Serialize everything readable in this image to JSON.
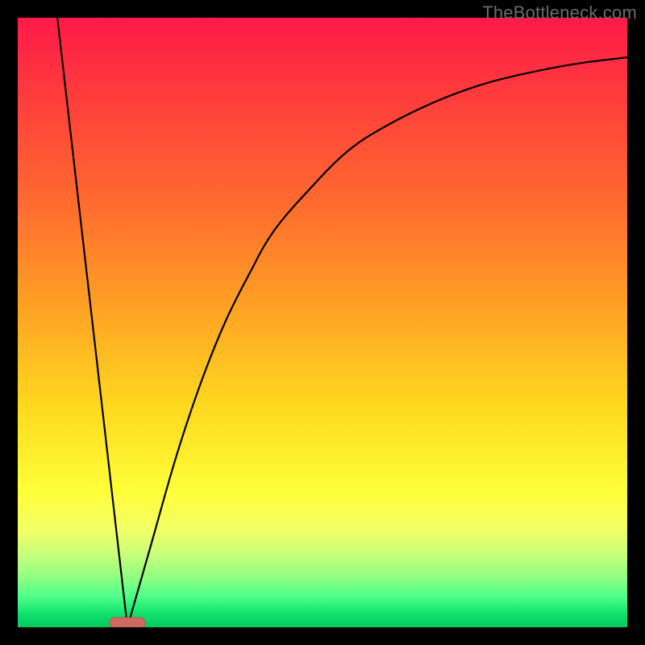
{
  "watermark": "TheBottleneck.com",
  "chart_data": {
    "type": "line",
    "title": "",
    "xlabel": "",
    "ylabel": "",
    "xlim": [
      0,
      100
    ],
    "ylim": [
      0,
      100
    ],
    "grid": false,
    "legend": false,
    "indicator": {
      "x": 18,
      "value": 0
    },
    "series": [
      {
        "name": "left-segment",
        "x": [
          6.5,
          18
        ],
        "values": [
          100,
          0
        ]
      },
      {
        "name": "right-segment",
        "x": [
          18,
          22,
          26,
          30,
          34,
          38,
          42,
          48,
          54,
          60,
          68,
          76,
          84,
          92,
          100
        ],
        "values": [
          0,
          14,
          28,
          40,
          50,
          58,
          65,
          72,
          78,
          82,
          86,
          89,
          91,
          92.5,
          93.5
        ]
      }
    ]
  }
}
